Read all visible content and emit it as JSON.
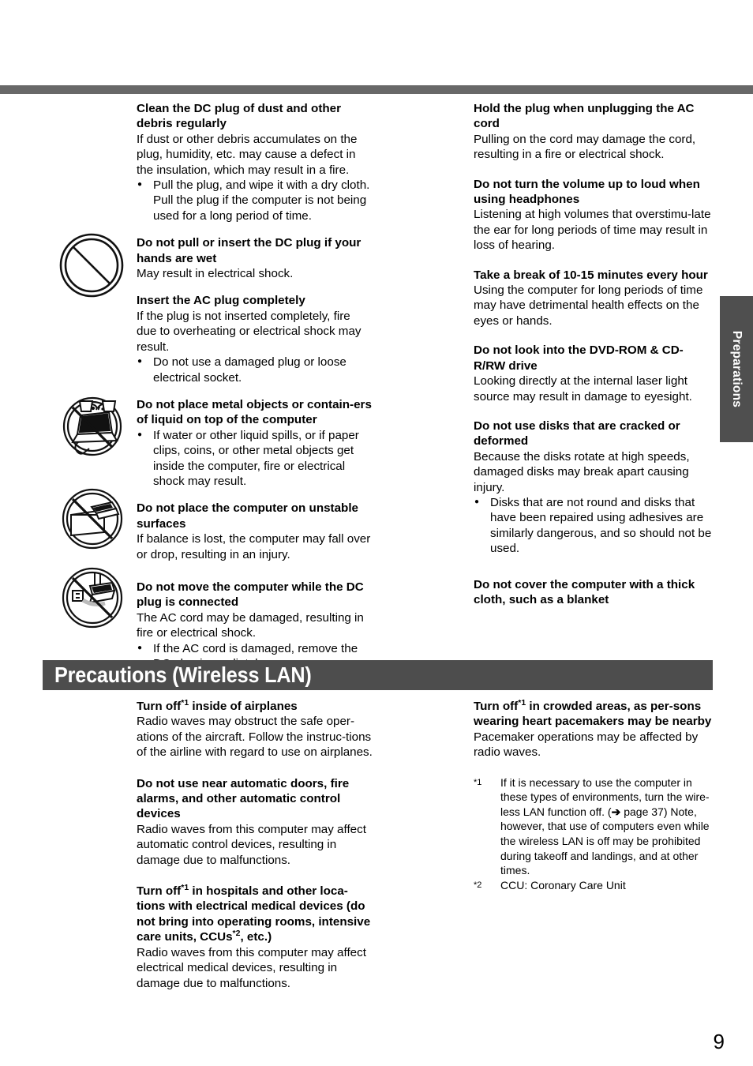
{
  "page": {
    "number": "9",
    "side_tab_label": "Preparations",
    "colors": {
      "top_rule": "#686868",
      "section_bar": "#4d4d4d",
      "side_tab": "#4f4f4f",
      "text": "#000000"
    }
  },
  "section_header": {
    "title": "Precautions (Wireless LAN)"
  },
  "icons": [
    {
      "name": "prohibition-sign-icon",
      "alt": "no entry / prohibited symbol"
    },
    {
      "name": "no-liquid-on-computer-icon",
      "alt": "no metal objects or containers of liquid on top of the computer"
    },
    {
      "name": "no-unstable-surface-icon",
      "alt": "do not place the computer on unstable surfaces"
    },
    {
      "name": "no-move-with-dc-plug-icon",
      "alt": "do not move the computer while the DC plug is connected"
    }
  ],
  "top_section": {
    "left_column": [
      {
        "heading": "Clean the DC plug of dust and other debris regularly",
        "body": "If dust or other debris accumulates on the plug, humidity, etc. may cause a defect in the insulation, which may result in a fire.",
        "bullets": [
          "Pull the plug, and wipe it with a dry cloth.\nPull the plug if the computer is not being used for a long period of time."
        ]
      },
      {
        "heading": "Do not pull or insert the DC plug if your hands are wet",
        "body": "May result in electrical shock.",
        "bullets": []
      },
      {
        "heading": "Insert the AC plug completely",
        "body": "If the plug is not inserted completely, fire due to overheating or electrical shock may result.",
        "bullets": [
          "Do not use a damaged plug or loose electrical socket."
        ]
      },
      {
        "heading": "Do not place metal objects or contain-​ers of liquid on top of the computer",
        "body": "",
        "bullets": [
          "If water or other liquid spills, or if paper clips, coins, or other metal objects get inside the computer, fire or electrical shock may result."
        ]
      },
      {
        "heading": "Do not place the computer on unstable surfaces",
        "body": "If balance is lost, the computer may fall over or drop, resulting in an injury.",
        "bullets": []
      },
      {
        "heading": "Do not move the computer while the DC plug is connected",
        "body": "The AC cord may be damaged, resulting in fire or electrical shock.",
        "bullets": [
          "If the AC cord is damaged, remove the DC plug immediately."
        ]
      }
    ],
    "right_column": [
      {
        "heading": "Hold the plug when unplugging the AC cord",
        "body": "Pulling on the cord may damage the cord, resulting in a fire or electrical shock.",
        "bullets": []
      },
      {
        "heading": "Do not turn the volume up to loud when using headphones",
        "body": "Listening at high volumes that overstimu-late the ear for long periods of time may result in loss of hearing.",
        "bullets": []
      },
      {
        "heading": "Take a break of 10-15 minutes every hour",
        "body": "Using the computer for long periods of time may have detrimental health effects on the eyes or hands.",
        "bullets": []
      },
      {
        "heading": "Do not look into the DVD-ROM & CD-R/RW drive",
        "body": "Looking directly at the internal laser light source may result in damage to eyesight.",
        "bullets": []
      },
      {
        "heading": "Do not use disks that are cracked or deformed",
        "body": "Because the disks rotate at high speeds, damaged disks may break apart causing injury.",
        "bullets": [
          "Disks that are not round and disks that have been repaired using adhesives are similarly dangerous, and so should not be used."
        ]
      },
      {
        "heading": "Do not cover the computer with a thick cloth, such as a blanket",
        "body": "",
        "bullets": []
      }
    ]
  },
  "wireless_section": {
    "left_column": [
      {
        "heading_pre": "Turn off",
        "heading_sup": "*1",
        "heading_post": " inside of airplanes",
        "body": "Radio waves may obstruct the safe oper-ations of the aircraft.  Follow the instruc-tions of the airline with regard to use on airplanes."
      },
      {
        "heading_pre": "Do not use near automatic doors, fire alarms, and other automatic control devices",
        "heading_sup": "",
        "heading_post": "",
        "body": "Radio waves from this computer may affect automatic control devices, resulting in damage due to malfunctions."
      },
      {
        "heading_pre": "Turn off",
        "heading_sup": "*1",
        "heading_post": " in hospitals and other loca-tions with electrical medical devices (do not bring into operating rooms, intensive care units, CCUs",
        "heading_sup2": "*2",
        "heading_post2": ", etc.)",
        "body": "Radio waves from this computer may affect electrical medical devices, resulting in damage due to malfunctions."
      }
    ],
    "right_column": [
      {
        "heading_pre": "Turn off",
        "heading_sup": "*1",
        "heading_post": " in crowded areas, as per-sons wearing heart pacemakers may be nearby",
        "body": "Pacemaker operations may be affected by radio waves."
      }
    ],
    "footnotes": [
      {
        "mark": "*1",
        "text_before_arrow": "If it is necessary to use the computer in these types of environments, turn the wire-less LAN function off. (",
        "arrow": "➔",
        "text_after_arrow": " page 37) Note, however, that use of computers even while the wireless LAN is off may be prohibited during takeoff and landings, and at other times."
      },
      {
        "mark": "*2",
        "text_before_arrow": "CCU: Coronary Care Unit",
        "arrow": "",
        "text_after_arrow": ""
      }
    ]
  }
}
